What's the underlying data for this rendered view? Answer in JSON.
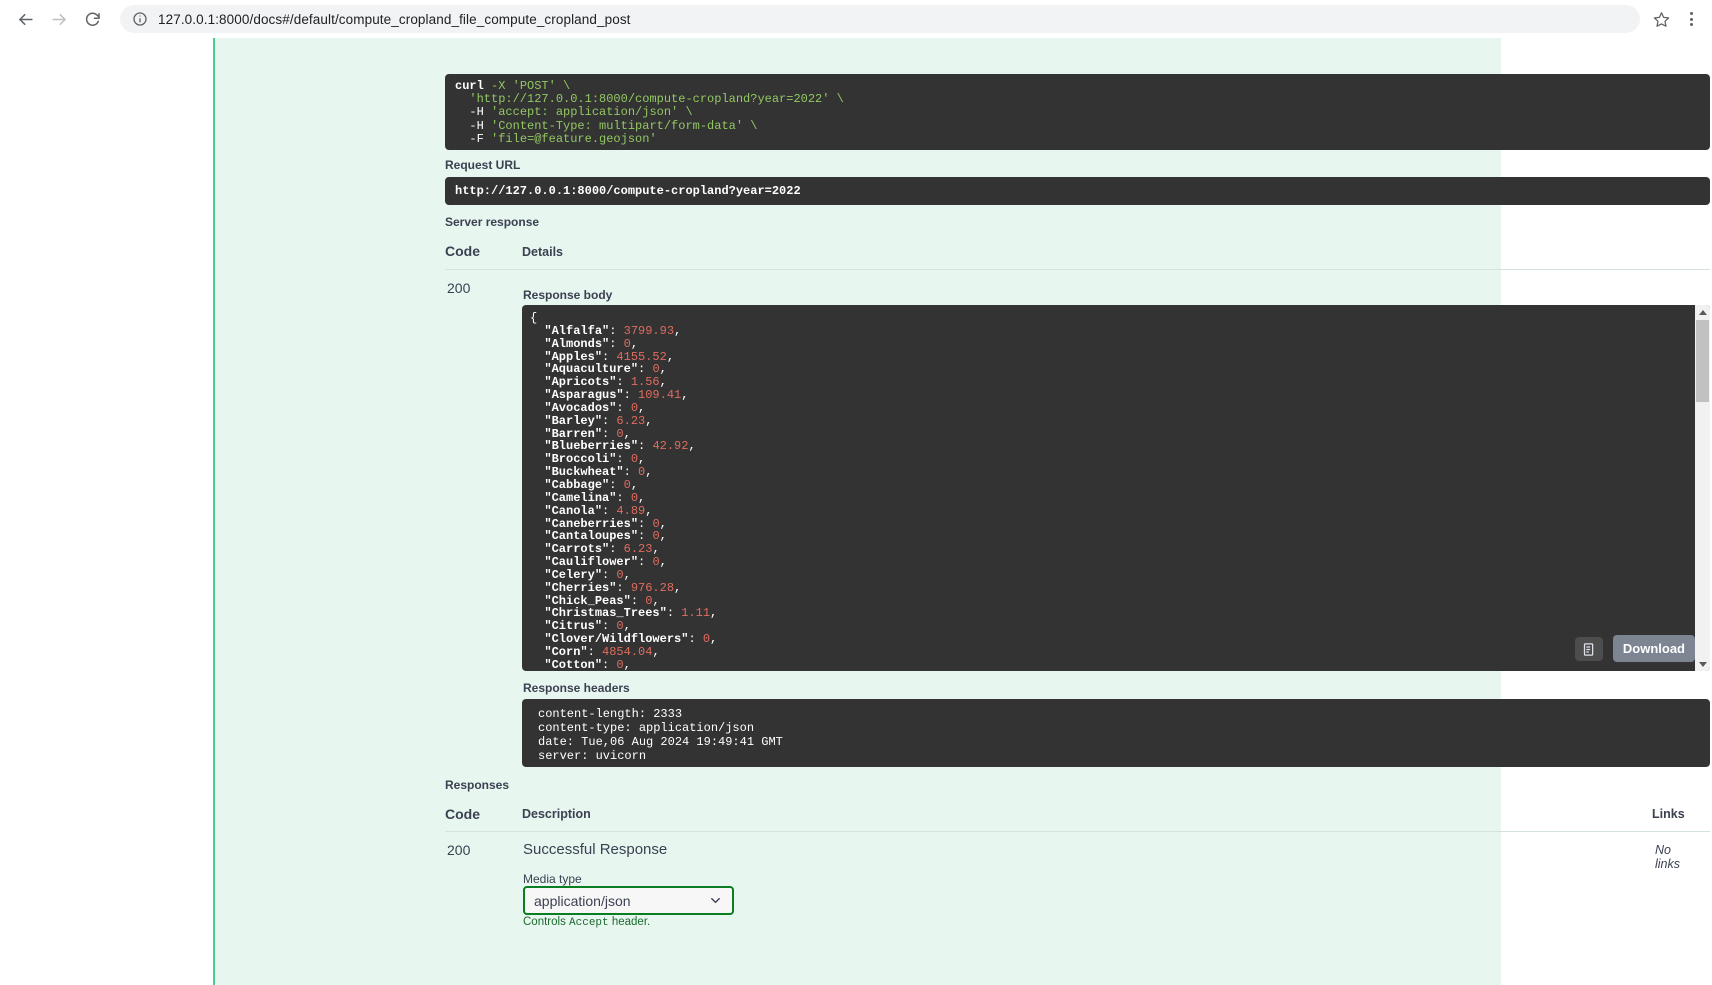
{
  "browser": {
    "url": "127.0.0.1:8000/docs#/default/compute_cropland_file_compute_cropland_post",
    "back_icon": "back-arrow-icon",
    "forward_icon": "forward-arrow-icon",
    "reload_icon": "reload-icon",
    "info_icon": "info-circle-icon",
    "star_icon": "star-icon",
    "menu_icon": "three-dot-menu-icon"
  },
  "curl": {
    "line1_cmd": "curl",
    "line1_rest": " -X 'POST' \\",
    "line2": "  'http://127.0.0.1:8000/compute-cropland?year=2022' \\",
    "line3_flag": "  -H ",
    "line3_str": "'accept: application/json'",
    "line4_flag": "  -H ",
    "line4_str": "'Content-Type: multipart/form-data'",
    "line5_flag": "  -F ",
    "line5_str": "'file=@feature.geojson'",
    "copy_icon": "copy-to-clipboard-icon"
  },
  "request_url": {
    "label": "Request URL",
    "value": "http://127.0.0.1:8000/compute-cropland?year=2022"
  },
  "server_response": {
    "label": "Server response",
    "col_code": "Code",
    "col_details": "Details",
    "code": "200",
    "response_body_label": "Response body",
    "response_headers_label": "Response headers",
    "download_label": "Download",
    "copy_icon": "copy-to-clipboard-icon",
    "scroll_up_icon": "scroll-up-arrow-icon",
    "scroll_down_icon": "scroll-down-arrow-icon"
  },
  "response_body": {
    "open_brace": "{",
    "entries": [
      {
        "key": "Alfalfa",
        "value": "3799.93"
      },
      {
        "key": "Almonds",
        "value": "0"
      },
      {
        "key": "Apples",
        "value": "4155.52"
      },
      {
        "key": "Aquaculture",
        "value": "0"
      },
      {
        "key": "Apricots",
        "value": "1.56"
      },
      {
        "key": "Asparagus",
        "value": "109.41"
      },
      {
        "key": "Avocados",
        "value": "0"
      },
      {
        "key": "Barley",
        "value": "6.23"
      },
      {
        "key": "Barren",
        "value": "0"
      },
      {
        "key": "Blueberries",
        "value": "42.92"
      },
      {
        "key": "Broccoli",
        "value": "0"
      },
      {
        "key": "Buckwheat",
        "value": "0"
      },
      {
        "key": "Cabbage",
        "value": "0"
      },
      {
        "key": "Camelina",
        "value": "0"
      },
      {
        "key": "Canola",
        "value": "4.89"
      },
      {
        "key": "Caneberries",
        "value": "0"
      },
      {
        "key": "Cantaloupes",
        "value": "0"
      },
      {
        "key": "Carrots",
        "value": "6.23"
      },
      {
        "key": "Cauliflower",
        "value": "0"
      },
      {
        "key": "Celery",
        "value": "0"
      },
      {
        "key": "Cherries",
        "value": "976.28"
      },
      {
        "key": "Chick_Peas",
        "value": "0"
      },
      {
        "key": "Christmas_Trees",
        "value": "1.11"
      },
      {
        "key": "Citrus",
        "value": "0"
      },
      {
        "key": "Clover/Wildflowers",
        "value": "0"
      },
      {
        "key": "Corn",
        "value": "4854.04"
      },
      {
        "key": "Cotton",
        "value": "0"
      }
    ]
  },
  "response_headers": {
    "lines": [
      "content-length: 2333",
      "content-type: application/json",
      "date: Tue,06 Aug 2024 19:49:41 GMT",
      "server: uvicorn"
    ]
  },
  "responses": {
    "label": "Responses",
    "col_code": "Code",
    "col_description": "Description",
    "col_links": "Links",
    "code": "200",
    "description": "Successful Response",
    "no_links": "No links",
    "media_type_label": "Media type",
    "media_type_value": "application/json",
    "chevron_icon": "chevron-down-icon",
    "controls_prefix": "Controls ",
    "controls_mono": "Accept",
    "controls_suffix": " header."
  },
  "colors": {
    "swagger_bg": "#e8f6f0",
    "accent_green": "#49cc90",
    "code_bg": "#333333",
    "json_number": "#e06c5f",
    "curl_string": "#93c763",
    "select_border": "#0b7d23",
    "download_btn": "#7d8492"
  }
}
